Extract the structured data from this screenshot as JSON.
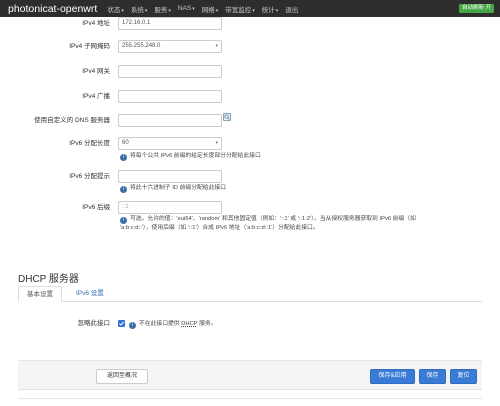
{
  "topbar": {
    "brand": "photonicat-openwrt",
    "menu": [
      "状态",
      "系统",
      "服务",
      "NAS",
      "网络",
      "带宽监控",
      "统计",
      "退出"
    ],
    "badge": "自动刷新 开"
  },
  "form": {
    "ipv4_addr": {
      "label": "IPv4 地址",
      "value": "172.16.0.1"
    },
    "netmask": {
      "label": "IPv4 子网掩码",
      "value": "255.255.248.0"
    },
    "gateway": {
      "label": "IPv4 网关",
      "value": ""
    },
    "broadcast": {
      "label": "IPv4 广播",
      "value": ""
    },
    "dns": {
      "label": "使用自定义的 DNS 服务器",
      "value": ""
    },
    "ip6assign": {
      "label": "IPv6 分配长度",
      "value": "60",
      "hint": "将每个公共 IPv6 前缀的给定长度部分分配给此接口"
    },
    "ip6hint": {
      "label": "IPv6 分配提示",
      "value": "",
      "hint": "将此十六进制子 ID 前缀分配给此接口"
    },
    "ip6ifaceid": {
      "label": "IPv6 后缀",
      "placeholder": "::1",
      "hint_line1": "可选。允许的值：'eui64'、'random' 和其他固定值（例如：'::1' 或 '::1:2'）。当从授权服务器获取到 IPv6 前缀（如",
      "hint_line2": "'a:b:c:d::'），使用后缀（如 '::1'）合成 IPv6 地址（'a:b:c:d::1'）分配给此接口。"
    }
  },
  "dhcp": {
    "title": "DHCP 服务器",
    "tabs": [
      "基本设置",
      "IPv6 设置"
    ],
    "ignore": {
      "label": "忽略此接口",
      "checked": true,
      "hint_pre": "不在此接口提供 ",
      "hint_abbr": "DHCP",
      "hint_post": " 服务。"
    }
  },
  "footer": {
    "back": "返回至概况",
    "save_apply": "保存&应用",
    "save": "保存",
    "reset": "复位"
  },
  "colors": {
    "topbar": "#2d2d2d",
    "primary": "#3a7bd5",
    "badge": "#46a546"
  }
}
